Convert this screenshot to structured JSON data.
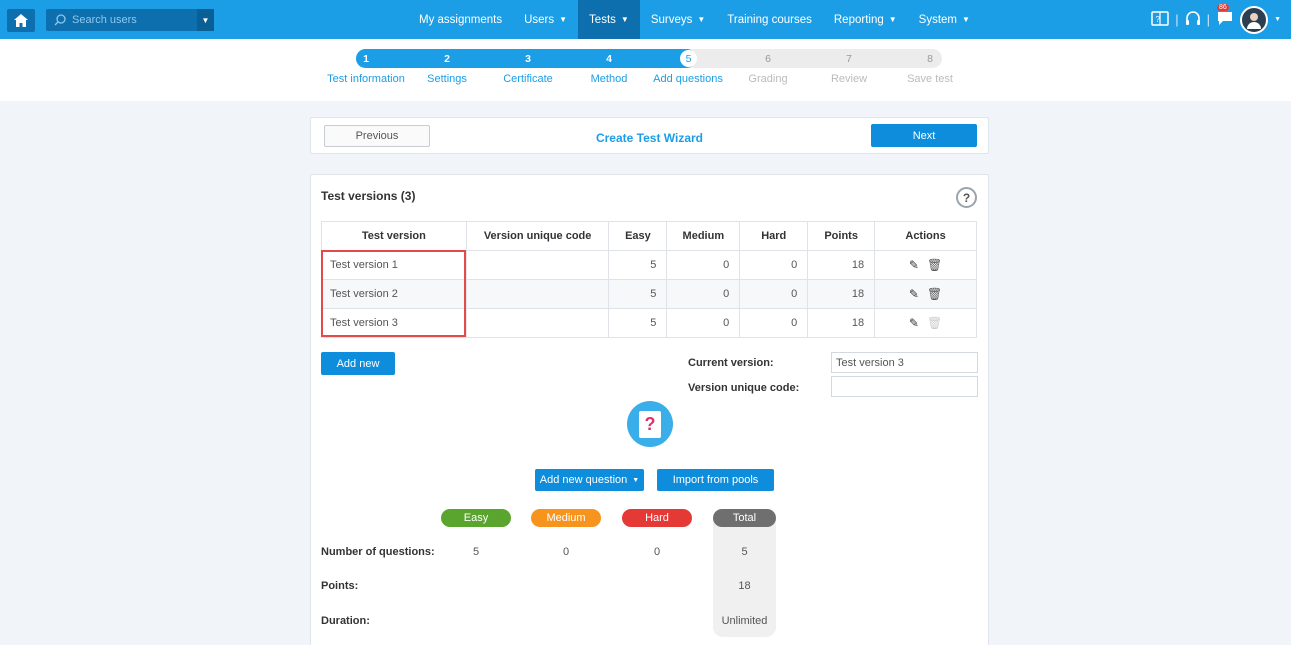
{
  "topbar": {
    "search_placeholder": "Search users",
    "menu": [
      {
        "label": "My assignments",
        "caret": false
      },
      {
        "label": "Users",
        "caret": true
      },
      {
        "label": "Tests",
        "caret": true
      },
      {
        "label": "Surveys",
        "caret": true
      },
      {
        "label": "Training courses",
        "caret": false
      },
      {
        "label": "Reporting",
        "caret": true
      },
      {
        "label": "System",
        "caret": true
      }
    ],
    "notification_count": "86"
  },
  "steps": [
    {
      "num": "1",
      "label": "Test information"
    },
    {
      "num": "2",
      "label": "Settings"
    },
    {
      "num": "3",
      "label": "Certificate"
    },
    {
      "num": "4",
      "label": "Method"
    },
    {
      "num": "5",
      "label": "Add questions"
    },
    {
      "num": "6",
      "label": "Grading"
    },
    {
      "num": "7",
      "label": "Review"
    },
    {
      "num": "8",
      "label": "Save test"
    }
  ],
  "current_step": 5,
  "wizard": {
    "previous_label": "Previous",
    "title": "Create Test Wizard",
    "next_label": "Next"
  },
  "versions": {
    "title": "Test versions (3)",
    "help": "?",
    "columns": [
      "Test version",
      "Version unique code",
      "Easy",
      "Medium",
      "Hard",
      "Points",
      "Actions"
    ],
    "rows": [
      {
        "name": "Test version 1",
        "code": "",
        "easy": "5",
        "medium": "0",
        "hard": "0",
        "points": "18"
      },
      {
        "name": "Test version 2",
        "code": "",
        "easy": "5",
        "medium": "0",
        "hard": "0",
        "points": "18"
      },
      {
        "name": "Test version 3",
        "code": "",
        "easy": "5",
        "medium": "0",
        "hard": "0",
        "points": "18"
      }
    ],
    "add_new_label": "Add new",
    "current_version_label": "Current version:",
    "current_version_value": "Test version 3",
    "unique_code_label": "Version unique code:",
    "unique_code_value": ""
  },
  "questions": {
    "add_question_label": "Add new question",
    "import_label": "Import from pools",
    "difficulty": {
      "easy": "Easy",
      "medium": "Medium",
      "hard": "Hard",
      "total": "Total"
    },
    "colors": {
      "easy": "#5aa52e",
      "medium": "#f7941d",
      "hard": "#e53935",
      "total": "#6f6f6f",
      "accent": "#1b9ee6"
    },
    "number_label": "Number of questions:",
    "points_label": "Points:",
    "duration_label": "Duration:",
    "number": {
      "easy": "5",
      "medium": "0",
      "hard": "0",
      "total": "5"
    },
    "points_total": "18",
    "duration_total": "Unlimited"
  }
}
